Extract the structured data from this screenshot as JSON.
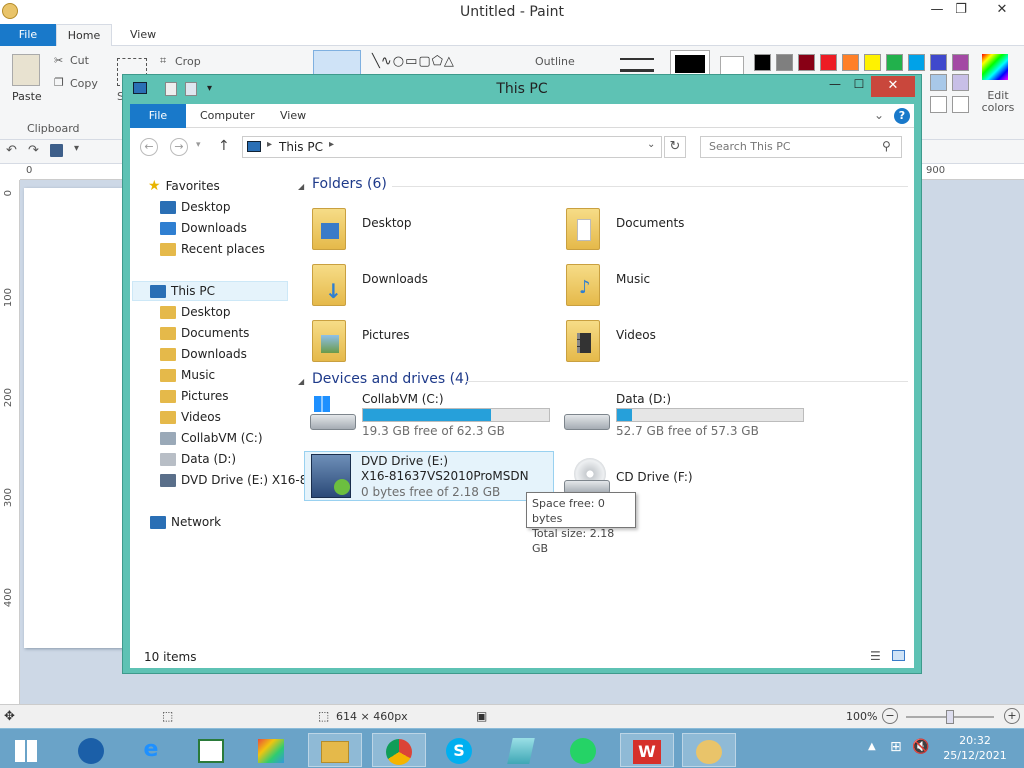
{
  "paint": {
    "title": "Untitled - Paint",
    "tabs": [
      "File",
      "Home",
      "View"
    ],
    "ribbon": {
      "paste": "Paste",
      "cut": "Cut",
      "copy": "Copy",
      "clipboard": "Clipboard",
      "crop": "Crop",
      "outline": "Outline",
      "edit_colors": "Edit colors",
      "select_letter": "S"
    },
    "ruler_top": [
      "0",
      "900"
    ],
    "ruler_left": [
      "0",
      "100",
      "200",
      "300",
      "400"
    ],
    "status": {
      "size": "614 × 460px",
      "zoom": "100%"
    },
    "palette": [
      "#000000",
      "#7f7f7f",
      "#880015",
      "#ed1c24",
      "#ff7f27",
      "#fff200",
      "#22b14c",
      "#00a2e8",
      "#3f48cc",
      "#a349a4"
    ]
  },
  "explorer": {
    "title": "This PC",
    "tabs": [
      "File",
      "Computer",
      "View"
    ],
    "address": "This PC",
    "search_placeholder": "Search This PC",
    "nav": {
      "favorites": "Favorites",
      "fav_items": [
        "Desktop",
        "Downloads",
        "Recent places"
      ],
      "this_pc": "This PC",
      "pc_items": [
        "Desktop",
        "Documents",
        "Downloads",
        "Music",
        "Pictures",
        "Videos",
        "CollabVM (C:)",
        "Data (D:)",
        "DVD Drive (E:) X16-8"
      ],
      "network": "Network"
    },
    "folders_header": "Folders (6)",
    "folders": [
      "Desktop",
      "Documents",
      "Downloads",
      "Music",
      "Pictures",
      "Videos"
    ],
    "devices_header": "Devices and drives (4)",
    "drives": [
      {
        "name": "CollabVM (C:)",
        "free": "19.3 GB free of 62.3 GB",
        "used_fraction": 0.69
      },
      {
        "name": "Data (D:)",
        "free": "52.7 GB free of 57.3 GB",
        "used_fraction": 0.08
      },
      {
        "name": "DVD Drive (E:)",
        "label": "X16-81637VS2010ProMSDN",
        "free": "0 bytes free of 2.18 GB"
      },
      {
        "name": "CD Drive (F:)"
      }
    ],
    "tooltip": {
      "line1": "Space free: 0 bytes",
      "line2": "Total size: 2.18 GB"
    },
    "status": "10 items"
  },
  "taskbar": {
    "time": "20:32",
    "date": "25/12/2021"
  }
}
